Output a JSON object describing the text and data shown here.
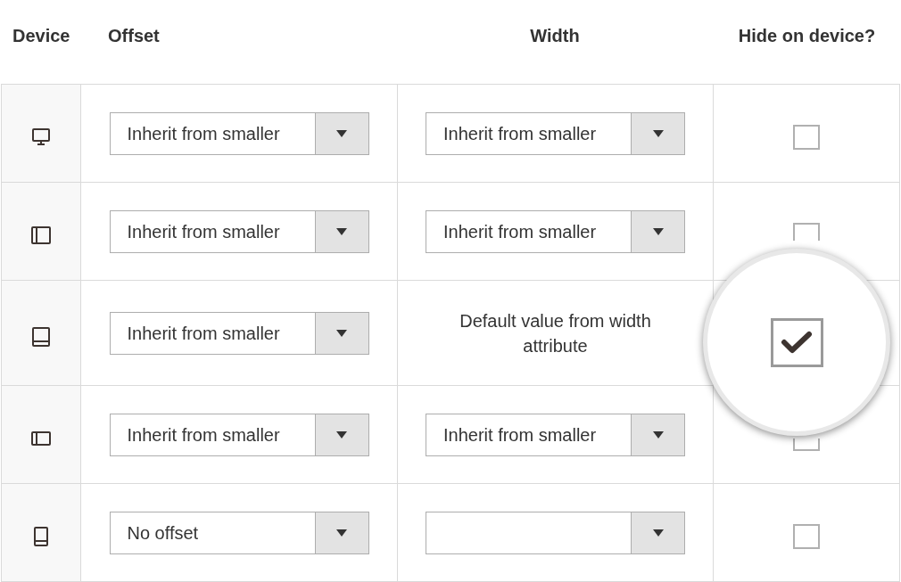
{
  "columns": [
    "Device",
    "Offset",
    "Width",
    "Hide on device?"
  ],
  "rows": [
    {
      "kind": "desktop",
      "offset": "Inherit from smaller",
      "width": {
        "kind": "select",
        "value": "Inherit from smaller"
      },
      "hide": {
        "checked": false,
        "magnified": false
      }
    },
    {
      "kind": "tablet-landscape",
      "offset": "Inherit from smaller",
      "width": {
        "kind": "select",
        "value": "Inherit from smaller"
      },
      "hide": {
        "checked": false,
        "magnified": false
      }
    },
    {
      "kind": "tablet-portrait",
      "offset": "Inherit from smaller",
      "width": {
        "kind": "text",
        "value": "Default value from width attribute"
      },
      "hide": {
        "checked": true,
        "magnified": true
      }
    },
    {
      "kind": "phone-landscape",
      "offset": "Inherit from smaller",
      "width": {
        "kind": "select",
        "value": "Inherit from smaller"
      },
      "hide": {
        "checked": false,
        "magnified": false
      }
    },
    {
      "kind": "phone-portrait",
      "offset": "No offset",
      "width": {
        "kind": "select"
      },
      "hide": {
        "checked": false,
        "magnified": false
      }
    }
  ]
}
